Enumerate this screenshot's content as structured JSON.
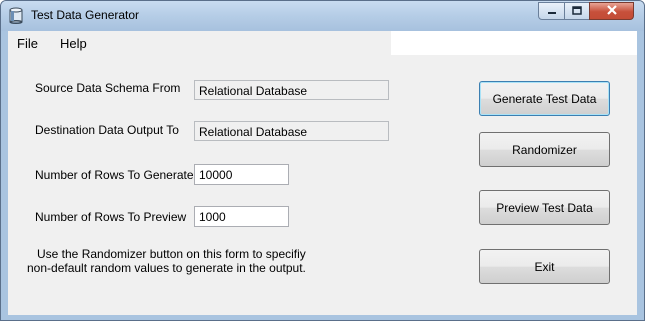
{
  "window": {
    "title": "Test Data Generator"
  },
  "menu": {
    "file": "File",
    "help": "Help"
  },
  "form": {
    "source_label": "Source Data Schema From",
    "source_value": "Relational Database",
    "destination_label": "Destination Data Output To",
    "destination_value": "Relational Database",
    "rows_generate_label": "Number of Rows To Generate",
    "rows_generate_value": "10000",
    "rows_preview_label": "Number of Rows To Preview",
    "rows_preview_value": "1000",
    "note_line1": "Use the Randomizer button on this form to specifiy",
    "note_line2": "non-default random values to generate in the output."
  },
  "buttons": {
    "generate": "Generate Test Data",
    "randomizer": "Randomizer",
    "preview": "Preview Test Data",
    "exit": "Exit"
  },
  "icons": {
    "app": "database-icon",
    "minimize": "minimize-icon",
    "maximize": "maximize-icon",
    "close": "close-icon"
  },
  "colors": {
    "titlebar": "#b5cde6",
    "client": "#f0f0f0",
    "close": "#c7503b"
  }
}
